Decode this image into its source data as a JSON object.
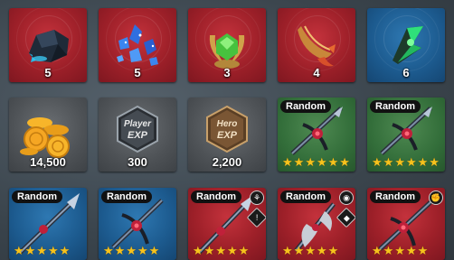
{
  "rewards": [
    {
      "id": "ore",
      "bg": "red",
      "quantity": "5",
      "icon": "dark-ore-icon"
    },
    {
      "id": "crystals",
      "bg": "red",
      "quantity": "5",
      "icon": "blue-crystal-icon"
    },
    {
      "id": "laurel",
      "bg": "red",
      "quantity": "3",
      "icon": "laurel-gem-icon"
    },
    {
      "id": "horn",
      "bg": "red",
      "quantity": "4",
      "icon": "horn-icon"
    },
    {
      "id": "green-shard",
      "bg": "blue",
      "quantity": "6",
      "icon": "green-shard-icon"
    },
    {
      "id": "coins",
      "bg": "gray",
      "quantity": "14,500",
      "icon": "gold-coins-icon"
    },
    {
      "id": "player-exp",
      "bg": "gray",
      "quantity": "300",
      "icon": "player-exp-icon",
      "line1": "Player",
      "line2": "EXP"
    },
    {
      "id": "hero-exp",
      "bg": "gray",
      "quantity": "2,200",
      "icon": "hero-exp-icon",
      "line1": "Hero",
      "line2": "EXP"
    },
    {
      "id": "weapon-a",
      "bg": "green",
      "badge": "Random",
      "stars": 6,
      "icon": "crossbow-icon"
    },
    {
      "id": "weapon-b",
      "bg": "green",
      "badge": "Random",
      "stars": 6,
      "icon": "crossbow-icon"
    },
    {
      "id": "weapon-c",
      "bg": "blue",
      "badge": "Random",
      "stars": 5,
      "icon": "spear-icon"
    },
    {
      "id": "weapon-d",
      "bg": "blue",
      "badge": "Random",
      "stars": 5,
      "icon": "crossbow-icon"
    },
    {
      "id": "weapon-e",
      "bg": "red",
      "badge": "Random",
      "stars": 5,
      "icon": "spear-icon",
      "chips": [
        "claw-chip-icon",
        "lock-chip-icon"
      ]
    },
    {
      "id": "weapon-f",
      "bg": "red",
      "badge": "Random",
      "stars": 5,
      "icon": "axe-icon",
      "chips": [
        "target-chip-icon",
        "shield-chip-icon"
      ]
    },
    {
      "id": "weapon-g",
      "bg": "red",
      "badge": "Random",
      "stars": 5,
      "icon": "crossbow-icon",
      "chips": [
        "fist-chip-icon"
      ]
    }
  ],
  "colors": {
    "star": "#f6c21d",
    "red": "#a5222b",
    "blue": "#1c5a8e",
    "gray": "#4e5256",
    "green": "#336e3a"
  }
}
